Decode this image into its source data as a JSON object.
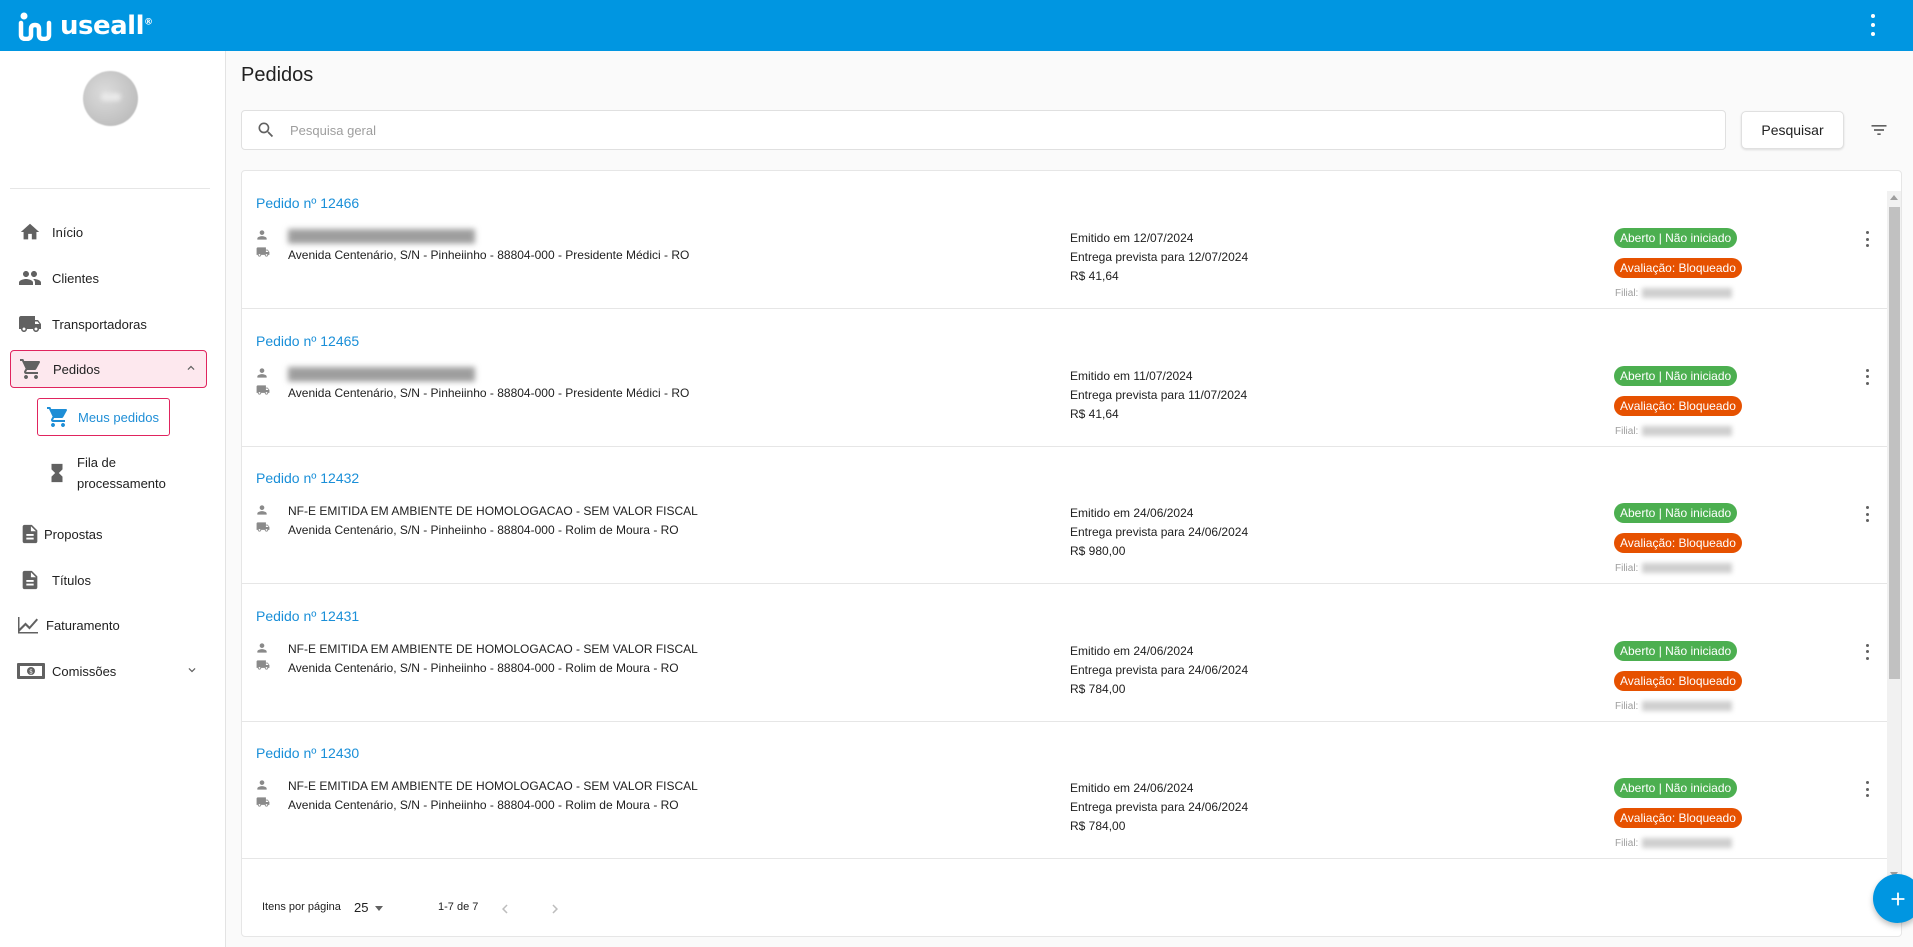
{
  "brand": {
    "name": "useall",
    "reg": "®"
  },
  "page": {
    "title": "Pedidos"
  },
  "search": {
    "placeholder": "Pesquisa geral",
    "button": "Pesquisar"
  },
  "sidebar": {
    "items": [
      {
        "label": "Início",
        "icon": "home-icon"
      },
      {
        "label": "Clientes",
        "icon": "people-icon"
      },
      {
        "label": "Transportadoras",
        "icon": "truck-icon"
      },
      {
        "label": "Pedidos",
        "icon": "cart-icon"
      },
      {
        "label": "Propostas",
        "icon": "document-icon"
      },
      {
        "label": "Títulos",
        "icon": "file-icon"
      },
      {
        "label": "Faturamento",
        "icon": "trending-up-icon"
      },
      {
        "label": "Comissões",
        "icon": "money-icon"
      }
    ],
    "subitems": [
      {
        "label": "Meus pedidos",
        "icon": "cart-icon"
      },
      {
        "label": "Fila de processamento",
        "icon": "hourglass-icon"
      }
    ]
  },
  "orders": [
    {
      "title": "Pedido nº 12466",
      "client": "",
      "address": "Avenida Centenário, S/N - Pinheiinho - 88804-000 - Presidente Médici - RO",
      "issued": "Emitido em 12/07/2024",
      "delivery": "Entrega prevista para 12/07/2024",
      "total": "R$ 41,64",
      "status": "Aberto | Não iniciado",
      "evaluation": "Avaliação: Bloqueado",
      "filial_label": "Filial:"
    },
    {
      "title": "Pedido nº 12465",
      "client": "",
      "address": "Avenida Centenário, S/N - Pinheiinho - 88804-000 - Presidente Médici - RO",
      "issued": "Emitido em 11/07/2024",
      "delivery": "Entrega prevista para 11/07/2024",
      "total": "R$ 41,64",
      "status": "Aberto | Não iniciado",
      "evaluation": "Avaliação: Bloqueado",
      "filial_label": "Filial:"
    },
    {
      "title": "Pedido nº 12432",
      "client": "NF-E EMITIDA EM AMBIENTE DE HOMOLOGACAO - SEM VALOR FISCAL",
      "address": "Avenida Centenário, S/N - Pinheiinho - 88804-000 - Rolim de Moura - RO",
      "issued": "Emitido em 24/06/2024",
      "delivery": "Entrega prevista para 24/06/2024",
      "total": "R$ 980,00",
      "status": "Aberto | Não iniciado",
      "evaluation": "Avaliação: Bloqueado",
      "filial_label": "Filial:"
    },
    {
      "title": "Pedido nº 12431",
      "client": "NF-E EMITIDA EM AMBIENTE DE HOMOLOGACAO - SEM VALOR FISCAL",
      "address": "Avenida Centenário, S/N - Pinheiinho - 88804-000 - Rolim de Moura - RO",
      "issued": "Emitido em 24/06/2024",
      "delivery": "Entrega prevista para 24/06/2024",
      "total": "R$ 784,00",
      "status": "Aberto | Não iniciado",
      "evaluation": "Avaliação: Bloqueado",
      "filial_label": "Filial:"
    },
    {
      "title": "Pedido nº 12430",
      "client": "NF-E EMITIDA EM AMBIENTE DE HOMOLOGACAO - SEM VALOR FISCAL",
      "address": "Avenida Centenário, S/N - Pinheiinho - 88804-000 - Rolim de Moura - RO",
      "issued": "Emitido em 24/06/2024",
      "delivery": "Entrega prevista para 24/06/2024",
      "total": "R$ 784,00",
      "status": "Aberto | Não iniciado",
      "evaluation": "Avaliação: Bloqueado",
      "filial_label": "Filial:"
    }
  ],
  "pager": {
    "label": "Itens por página",
    "size": "25",
    "range": "1-7 de 7"
  },
  "colors": {
    "brand": "#0096e1",
    "link": "#1a8fd8",
    "status_green": "#4caf50",
    "status_orange": "#e65100",
    "highlight": "#e0245e"
  }
}
